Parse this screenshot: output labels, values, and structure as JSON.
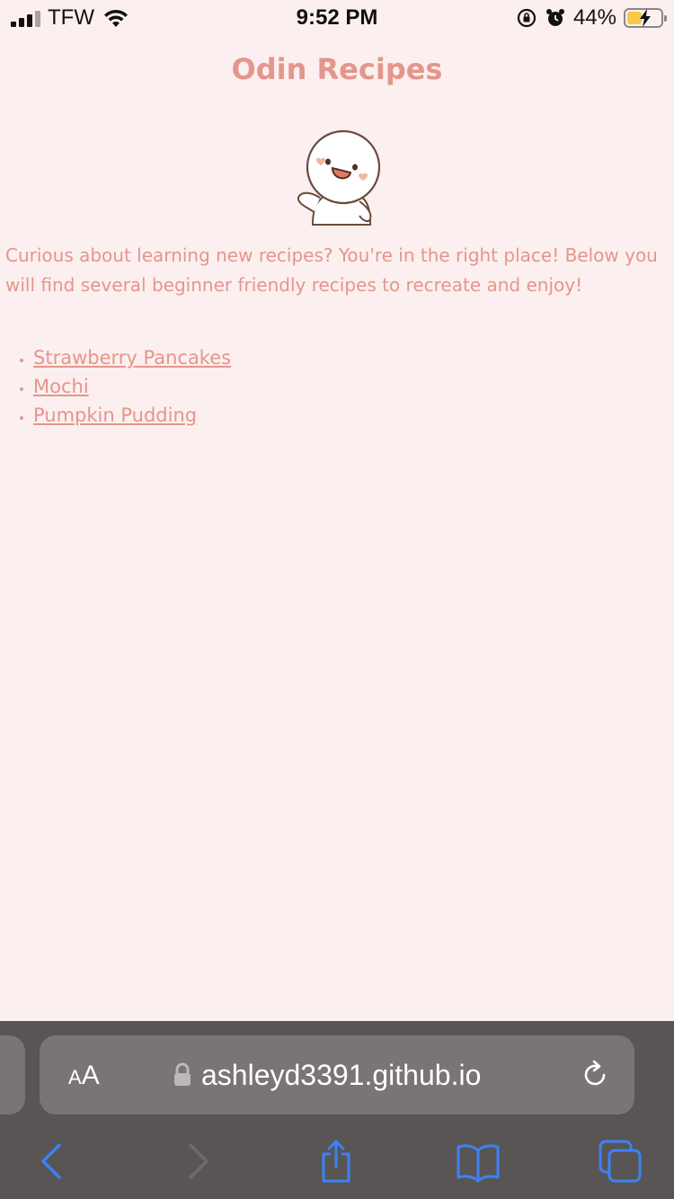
{
  "status_bar": {
    "carrier": "TFW",
    "time": "9:52 PM",
    "battery_percent": "44%",
    "battery_level": 0.44,
    "icons": [
      "signal-icon",
      "wifi-icon",
      "orientation-lock-icon",
      "alarm-icon",
      "battery-charging-icon"
    ]
  },
  "page": {
    "title": "Odin Recipes",
    "intro": "Curious about learning new recipes? You're in the right place! Below you will find several beginner friendly recipes to recreate and enjoy!",
    "recipes": [
      {
        "label": "Strawberry Pancakes"
      },
      {
        "label": "Mochi"
      },
      {
        "label": "Pumpkin Pudding"
      }
    ],
    "colors": {
      "background": "#fcefef",
      "accent": "#e4968c"
    }
  },
  "browser": {
    "text_size_small": "A",
    "text_size_large": "A",
    "url": "ashleyd3391.github.io",
    "toolbar_icons": [
      "back-icon",
      "forward-icon",
      "share-icon",
      "bookmarks-icon",
      "tabs-icon"
    ],
    "chrome_color": "#595554",
    "link_blue": "#3b82f6"
  }
}
